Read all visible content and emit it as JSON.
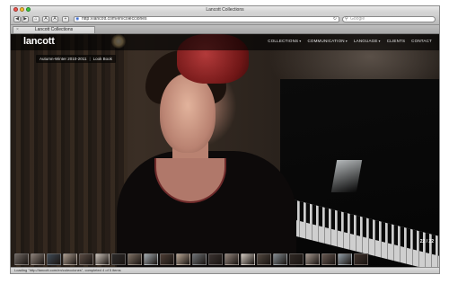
{
  "window": {
    "title": "Lancott Collections",
    "traffic_lights": [
      "#f2534c",
      "#f7bd2e",
      "#38c83f"
    ]
  },
  "toolbar": {
    "back_icon": "back-arrow-icon",
    "forward_icon": "forward-arrow-icon",
    "url": "http://lancott.com/en/colecciones",
    "search_placeholder": "Google"
  },
  "tab": {
    "title": "Lancott Collections"
  },
  "site": {
    "logo": "lancott",
    "nav": [
      {
        "label": "COLLECTIONS",
        "dropdown": true
      },
      {
        "label": "COMMUNICATION",
        "dropdown": true
      },
      {
        "label": "LANGUAGE",
        "dropdown": true
      },
      {
        "label": "CLIENTS",
        "dropdown": false
      },
      {
        "label": "CONTACT",
        "dropdown": false
      }
    ],
    "subnav": [
      "Autumn-Winter 2010-2011",
      "Look Book"
    ],
    "counter": "22 / 22",
    "thumbnails_count": 22
  },
  "status": {
    "text": "Loading \"http://lancott.com/en/colecciones\", completed 4 of 5 items"
  },
  "colors": {
    "thumbnail_tones": [
      "#6d6560",
      "#8a7e76",
      "#3f4a55",
      "#a99a8d",
      "#5a4c44",
      "#c8bfb6",
      "#2c2a2a",
      "#7c6e62",
      "#9fa7ad",
      "#4d3d35",
      "#b4a290",
      "#6a6e72",
      "#3a3230",
      "#908279",
      "#cdc4bb",
      "#51473f",
      "#7f878d",
      "#2f2824",
      "#a0938a",
      "#665851",
      "#8e9aa3",
      "#3d302a"
    ]
  }
}
